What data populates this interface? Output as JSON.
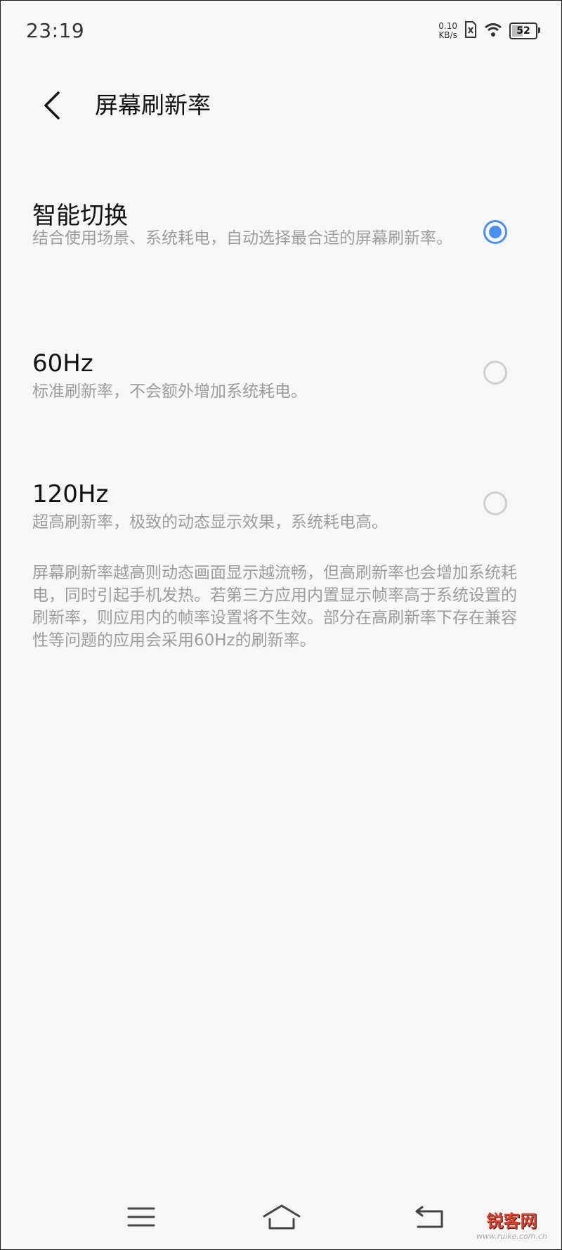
{
  "status_bar": {
    "time": "23:19",
    "net_speed_value": "0.10",
    "net_speed_unit": "KB/s",
    "battery": "52",
    "battery_level": 0.52,
    "icons": [
      "no-sim-icon",
      "wifi-icon",
      "battery-icon"
    ]
  },
  "header": {
    "title": "屏幕刷新率",
    "back_icon": "chevron-left-icon"
  },
  "options": [
    {
      "title": "智能切换",
      "description": "结合使用场景、系统耗电，自动选择最合适的屏幕刷新率。",
      "selected": true
    },
    {
      "title": "60Hz",
      "description": "标准刷新率，不会额外增加系统耗电。",
      "selected": false
    },
    {
      "title": "120Hz",
      "description": "超高刷新率，极致的动态显示效果，系统耗电高。",
      "selected": false
    }
  ],
  "footnote": "屏幕刷新率越高则动态画面显示越流畅，但高刷新率也会增加系统耗电，同时引起手机发热。若第三方应用内置显示帧率高于系统设置的刷新率，则应用内的帧率设置将不生效。部分在高刷新率下存在兼容性等问题的应用会采用60Hz的刷新率。",
  "nav_bar": {
    "icons": [
      "menu-icon",
      "home-icon",
      "back-icon"
    ]
  },
  "watermark": {
    "text": "锐客网",
    "url": "www.ruike.com.cn"
  },
  "colors": {
    "accent": "#4c8ff0",
    "secondary_text": "#9d9d9d",
    "background": "#f7f7f7"
  }
}
